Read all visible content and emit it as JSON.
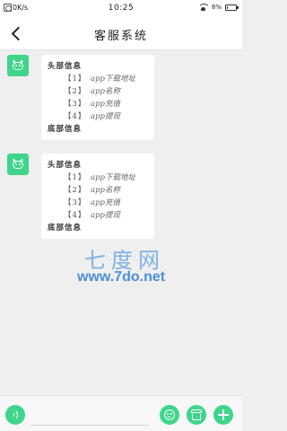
{
  "status_bar": {
    "left_text": "0K/s",
    "time": "10:25",
    "battery": "8%",
    "battery_level": 0.08
  },
  "header": {
    "title": "客服系统"
  },
  "messages": [
    {
      "header": "头部信息",
      "items": [
        {
          "num": "【1】",
          "text": "app下载地址"
        },
        {
          "num": "【2】",
          "text": "app名称"
        },
        {
          "num": "【3】",
          "text": "app充值"
        },
        {
          "num": "【4】",
          "text": "app提现"
        }
      ],
      "footer": "底部信息"
    },
    {
      "header": "头部信息",
      "items": [
        {
          "num": "【1】",
          "text": "app下载地址"
        },
        {
          "num": "【2】",
          "text": "app名称"
        },
        {
          "num": "【3】",
          "text": "app充值"
        },
        {
          "num": "【4】",
          "text": "app提现"
        }
      ],
      "footer": "底部信息"
    }
  ],
  "watermark": {
    "top": "七度网",
    "bottom": "www.7do.net"
  },
  "composer": {
    "input_value": ""
  },
  "colors": {
    "accent": "#3fd58a",
    "background": "#efefef"
  }
}
